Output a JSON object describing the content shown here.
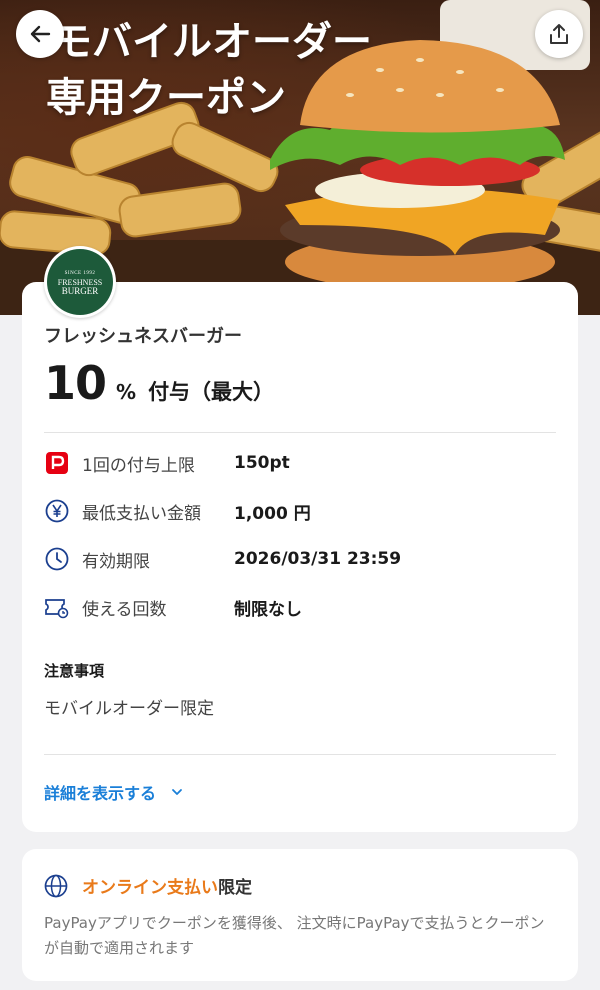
{
  "header": {
    "title_line1": "モバイルオーダー",
    "title_line2": "専用クーポン"
  },
  "coupon": {
    "merchant": "フレッシュネスバーガー",
    "logo_text": {
      "since": "SINCE 1992",
      "name1": "FRESHNESS",
      "name2": "BURGER"
    },
    "rate": "10",
    "rate_unit": "%",
    "rate_suffix": "付与（最大）",
    "details": [
      {
        "icon": "paypay-icon",
        "label": "1回の付与上限",
        "value": "150pt"
      },
      {
        "icon": "yen-icon",
        "label": "最低支払い金額",
        "value": "1,000 円"
      },
      {
        "icon": "clock-icon",
        "label": "有効期限",
        "value": "2026/03/31 23:59"
      },
      {
        "icon": "ticket-icon",
        "label": "使える回数",
        "value": "制限なし"
      }
    ],
    "notes_title": "注意事項",
    "notes_body": "モバイルオーダー限定",
    "detail_link": "詳細を表示する"
  },
  "online": {
    "highlight": "オンライン支払い",
    "suffix": "限定",
    "body": "PayPayアプリでクーポンを獲得後、 注文時にPayPayで支払うとクーポンが自動で適用されます"
  },
  "colors": {
    "accent_blue": "#1a7fd8",
    "accent_orange": "#e97a1a",
    "paypay_red": "#e60012",
    "logo_green": "#1d5a3a"
  }
}
